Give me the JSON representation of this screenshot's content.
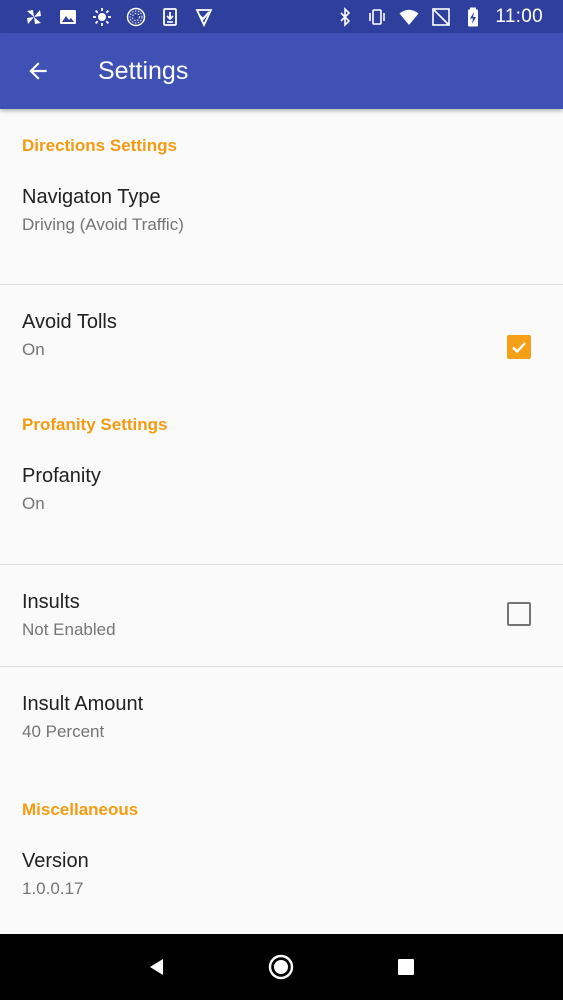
{
  "status_bar": {
    "time": "11:00",
    "left_icons": [
      "pinwheel-icon",
      "image-icon",
      "sun-icon",
      "circle-pattern-icon",
      "download-icon",
      "checkmark-app-icon"
    ],
    "right_icons": [
      "bluetooth-icon",
      "vibrate-icon",
      "wifi-icon",
      "no-signal-icon",
      "battery-charging-icon"
    ]
  },
  "app_bar": {
    "title": "Settings",
    "background": "#3f51b5"
  },
  "accent_color": "#f39c12",
  "sections": {
    "directions": {
      "header": "Directions Settings",
      "navigation_type": {
        "title": "Navigaton Type",
        "summary": "Driving (Avoid Traffic)"
      },
      "avoid_tolls": {
        "title": "Avoid Tolls",
        "summary": "On",
        "checked": true
      }
    },
    "profanity": {
      "header": "Profanity Settings",
      "profanity": {
        "title": "Profanity",
        "summary": "On"
      },
      "insults": {
        "title": "Insults",
        "summary": "Not Enabled",
        "checked": false
      },
      "insult_amount": {
        "title": "Insult Amount",
        "summary": "40 Percent"
      }
    },
    "misc": {
      "header": "Miscellaneous",
      "version": {
        "title": "Version",
        "summary": "1.0.0.17"
      }
    }
  },
  "nav_bar": {
    "buttons": [
      "back-triangle-icon",
      "home-circle-icon",
      "recents-square-icon"
    ]
  }
}
